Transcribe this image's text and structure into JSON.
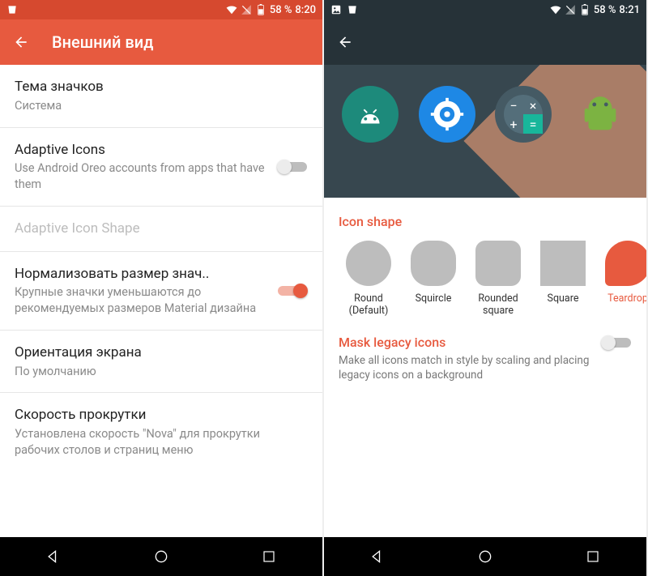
{
  "left": {
    "status": {
      "battery": "58 %",
      "time": "8:20"
    },
    "title": "Внешний вид",
    "rows": {
      "icon_theme": {
        "label": "Тема значков",
        "value": "Система"
      },
      "adaptive": {
        "label": "Adaptive Icons",
        "desc": "Use Android Oreo accounts from apps that have them",
        "on": false
      },
      "adaptive_shape": {
        "label": "Adaptive Icon Shape",
        "disabled": true
      },
      "normalize": {
        "label": "Нормализовать размер знач..",
        "desc": "Крупные значки уменьшаются до рекомендуемых размеров Material дизайна",
        "on": true
      },
      "orientation": {
        "label": "Ориентация экрана",
        "value": "По умолчанию"
      },
      "scroll": {
        "label": "Скорость прокрутки",
        "value": "Установлена скорость \"Nova\" для прокрутки рабочих столов и страниц меню"
      }
    }
  },
  "right": {
    "status": {
      "battery": "58 %",
      "time": "8:21"
    },
    "icon_shape_title": "Icon shape",
    "shapes": [
      {
        "key": "round",
        "label": "Round (Default)"
      },
      {
        "key": "squircle",
        "label": "Squircle"
      },
      {
        "key": "rsquare",
        "label": "Rounded square"
      },
      {
        "key": "square",
        "label": "Square"
      },
      {
        "key": "tear",
        "label": "Teardrop",
        "selected": true
      }
    ],
    "mask": {
      "title": "Mask legacy icons",
      "desc": "Make all icons match in style by scaling and placing legacy icons on a background",
      "on": false
    }
  },
  "icons": {
    "wifi": "wifi-icon",
    "signal": "cell-signal-icon",
    "battery": "battery-icon",
    "image": "image-notif-icon",
    "check": "check-notif-icon"
  }
}
